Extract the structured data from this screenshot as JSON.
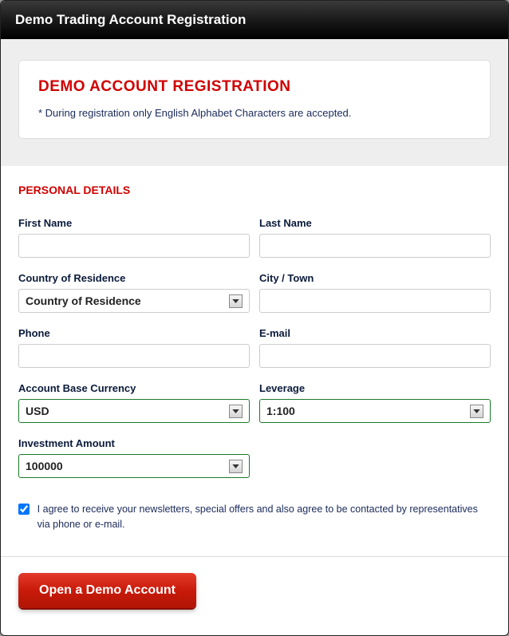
{
  "modal": {
    "title": "Demo Trading Account Registration"
  },
  "infoBox": {
    "heading": "DEMO ACCOUNT REGISTRATION",
    "note": "* During registration only English Alphabet Characters are accepted."
  },
  "form": {
    "sectionTitle": "PERSONAL DETAILS",
    "firstName": {
      "label": "First Name",
      "value": ""
    },
    "lastName": {
      "label": "Last Name",
      "value": ""
    },
    "country": {
      "label": "Country of Residence",
      "selected": "Country of Residence"
    },
    "city": {
      "label": "City / Town",
      "value": ""
    },
    "phone": {
      "label": "Phone",
      "value": ""
    },
    "email": {
      "label": "E-mail",
      "value": ""
    },
    "currency": {
      "label": "Account Base Currency",
      "selected": "USD"
    },
    "leverage": {
      "label": "Leverage",
      "selected": "1:100"
    },
    "investment": {
      "label": "Investment Amount",
      "selected": "100000"
    },
    "consent": {
      "checked": true,
      "text": "I agree to receive your newsletters, special offers and also agree to be contacted by representatives via phone or e-mail."
    },
    "submitLabel": "Open a Demo Account"
  }
}
